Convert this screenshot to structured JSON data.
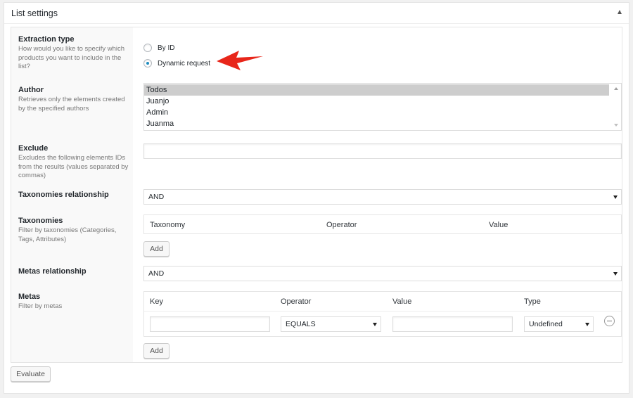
{
  "panel": {
    "title": "List settings"
  },
  "extraction": {
    "title": "Extraction type",
    "description": "How would you like to specify which products you want to include in the list?",
    "options": [
      {
        "label": "By ID",
        "checked": false
      },
      {
        "label": "Dynamic request",
        "checked": true
      }
    ]
  },
  "author": {
    "title": "Author",
    "description": "Retrieves only the elements created by the specified authors",
    "items": [
      "Todos",
      "Juanjo",
      "Admin",
      "Juanma"
    ],
    "selected": "Todos"
  },
  "exclude": {
    "title": "Exclude",
    "description": "Excludes the following elements IDs from the results (values separated by commas)",
    "value": ""
  },
  "taxonomies_relationship": {
    "title": "Taxonomies relationship",
    "value": "AND"
  },
  "taxonomies": {
    "title": "Taxonomies",
    "description": "Filter by taxonomies (Categories, Tags, Attributes)",
    "columns": [
      "Taxonomy",
      "Operator",
      "Value"
    ],
    "add_label": "Add"
  },
  "metas_relationship": {
    "title": "Metas relationship",
    "value": "AND"
  },
  "metas": {
    "title": "Metas",
    "description": "Filter by metas",
    "columns": [
      "Key",
      "Operator",
      "Value",
      "Type"
    ],
    "row": {
      "key": "",
      "operator": "EQUALS",
      "value": "",
      "type": "Undefined"
    },
    "add_label": "Add"
  },
  "footer": {
    "evaluate_label": "Evaluate"
  },
  "icons": {
    "collapse": "triangle-up-icon",
    "annotation": "red-arrow-icon",
    "remove": "minus-circle-icon"
  },
  "colors": {
    "annotation_arrow": "#e8261a",
    "radio_dot": "#1e8cbe"
  }
}
